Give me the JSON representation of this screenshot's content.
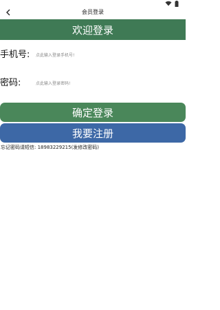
{
  "header": {
    "title": "会员登录",
    "back_icon": "back-arrow-icon"
  },
  "status_bar": {
    "icons": [
      "wifi-icon",
      "battery-icon"
    ]
  },
  "banner": {
    "text": "欢迎登录",
    "color": "#3f7a55"
  },
  "form": {
    "phone_label": "手机号:",
    "phone_placeholder": "点此输入登录手机号!",
    "password_label": "密码:",
    "password_placeholder": "点此输入登录密码!"
  },
  "buttons": {
    "confirm_label": "确定登录",
    "confirm_color": "#4a875a",
    "register_label": "我要注册",
    "register_color": "#3d68a6"
  },
  "footer": {
    "forgot_text": "忘记密码请短信: 18983229215(发修改密码)"
  }
}
